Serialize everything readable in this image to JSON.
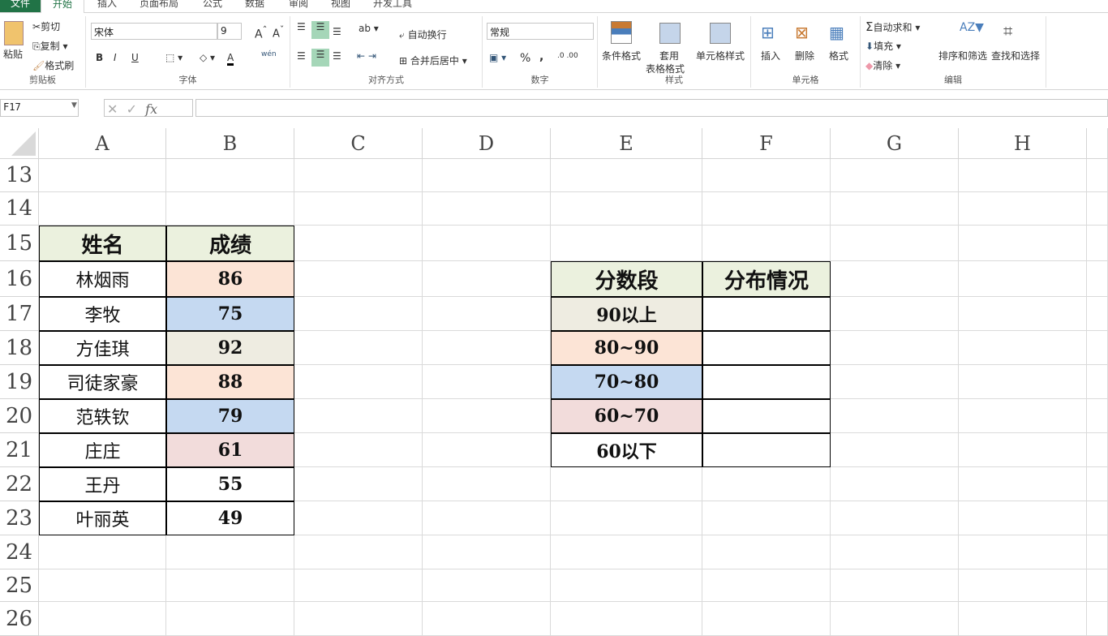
{
  "tabs": [
    "文件",
    "开始",
    "插入",
    "页面布局",
    "公式",
    "数据",
    "审阅",
    "视图",
    "开发工具"
  ],
  "clipboard": {
    "paste": "粘贴",
    "cut": "剪切",
    "copy": "复制",
    "painter": "格式刷",
    "label": "剪贴板"
  },
  "font": {
    "name": "宋体",
    "size": "9",
    "label": "字体",
    "bold": "B",
    "italic": "I",
    "underline": "U",
    "phonetic": "wén"
  },
  "align": {
    "wrap": "自动换行",
    "merge": "合并后居中",
    "label": "对齐方式"
  },
  "number": {
    "format": "常规",
    "percent": "%",
    "comma": ",",
    "label": "数字"
  },
  "styles": {
    "cond": "条件格式",
    "table1": "套用",
    "table2": "表格格式",
    "cell": "单元格样式",
    "label": "样式"
  },
  "cells": {
    "insert": "插入",
    "delete": "删除",
    "format": "格式",
    "label": "单元格"
  },
  "editing": {
    "autosum": "自动求和",
    "fill": "填充",
    "clear": "清除",
    "sort": "排序和筛选",
    "find": "查找和选择",
    "label": "编辑"
  },
  "formula_bar": {
    "name_box": "F17",
    "fx": "fx",
    "value": ""
  },
  "columns": [
    "A",
    "B",
    "C",
    "D",
    "E",
    "F",
    "G",
    "H"
  ],
  "rows": [
    "13",
    "14",
    "15",
    "16",
    "17",
    "18",
    "19",
    "20",
    "21",
    "22",
    "23",
    "24",
    "25",
    "26"
  ],
  "scores": {
    "headers": [
      "姓名",
      "成绩"
    ],
    "rows": [
      [
        "林烟雨",
        "86"
      ],
      [
        "李牧",
        "75"
      ],
      [
        "方佳琪",
        "92"
      ],
      [
        "司徒家豪",
        "88"
      ],
      [
        "范轶钦",
        "79"
      ],
      [
        "庄庄",
        "61"
      ],
      [
        "王丹",
        "55"
      ],
      [
        "叶丽英",
        "49"
      ]
    ]
  },
  "distribution": {
    "headers": [
      "分数段",
      "分布情况"
    ],
    "rows": [
      [
        "90以上",
        ""
      ],
      [
        "80~90",
        ""
      ],
      [
        "70~80",
        ""
      ],
      [
        "60~70",
        ""
      ],
      [
        "60以下",
        ""
      ]
    ]
  },
  "colors": {
    "header": "#ebf1de",
    "peach": "#fce4d6",
    "blue": "#c5d9f1",
    "beige": "#eeece1",
    "pink": "#f2dcdb",
    "accent": "#217346"
  }
}
